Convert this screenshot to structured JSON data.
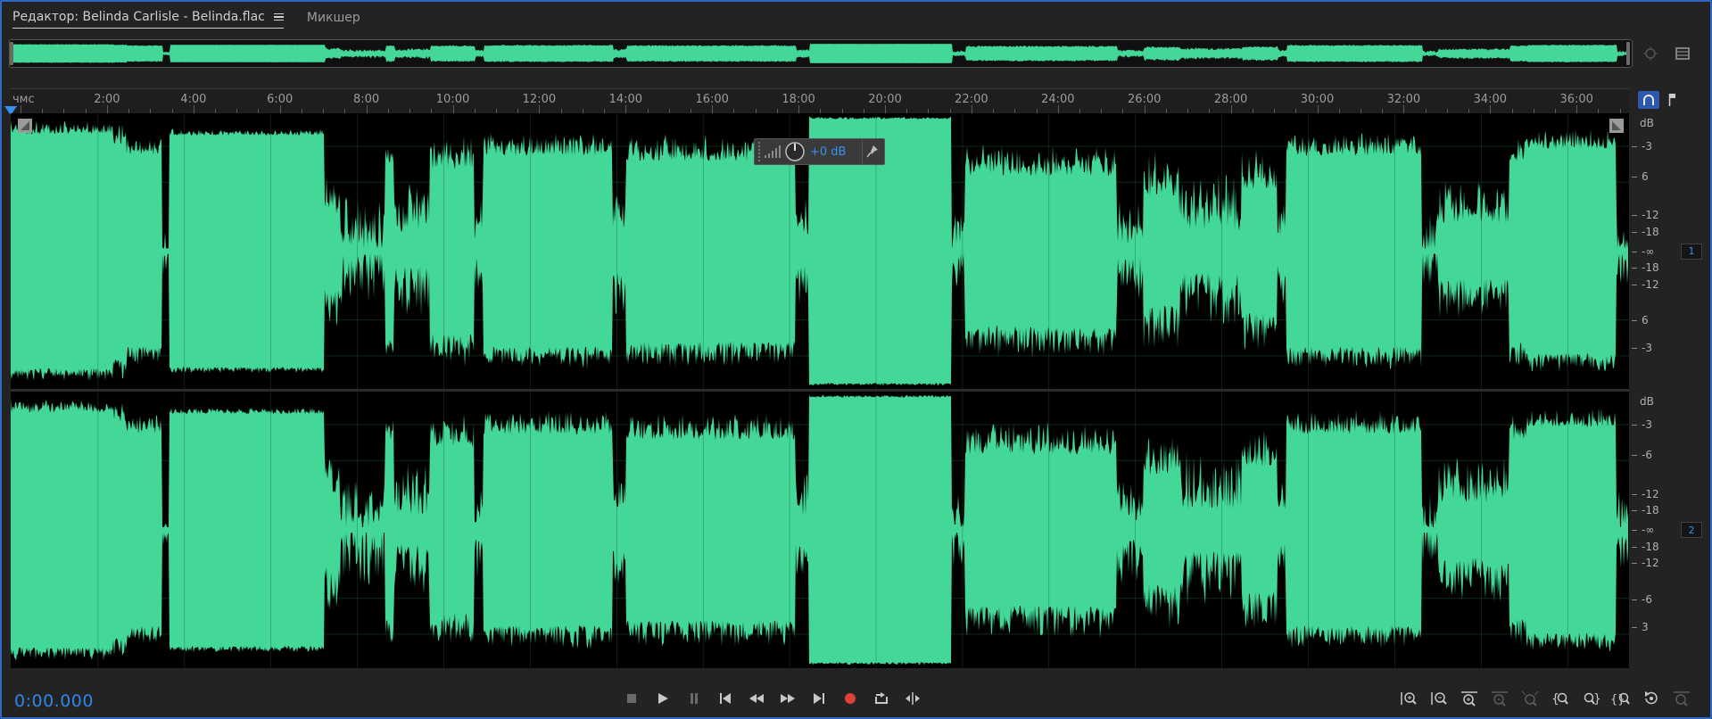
{
  "tabs": {
    "editor": "Редактор: Belinda Carlisle - Belinda.flac",
    "mixer": "Микшер"
  },
  "ruler": {
    "unit": "чмс",
    "labels": [
      "2:00",
      "4:00",
      "6:00",
      "8:00",
      "10:00",
      "12:00",
      "14:00",
      "16:00",
      "18:00",
      "20:00",
      "22:00",
      "24:00",
      "26:00",
      "28:00",
      "30:00",
      "32:00",
      "34:00",
      "36:00"
    ]
  },
  "hud": {
    "value": "+0 dB"
  },
  "db_scale": {
    "channel1": {
      "header": "dB",
      "labels": [
        "-3",
        "6",
        "-12",
        "-18",
        "-∞",
        "-18",
        "-12",
        "6",
        "-3"
      ],
      "badge": "1"
    },
    "channel2": {
      "header": "dB",
      "labels": [
        "-3",
        "-6",
        "-12",
        "-18",
        "-∞",
        "-18",
        "-12",
        "-6",
        "3"
      ],
      "badge": "2"
    }
  },
  "time": "0:00.000",
  "colors": {
    "waveform": "#43d898",
    "accent": "#2e86e6",
    "record": "#e0403a",
    "background": "#232323"
  },
  "icons": {
    "transport": [
      "stop-icon",
      "play-icon",
      "pause-icon",
      "go-to-start-icon",
      "rewind-icon",
      "fast-forward-icon",
      "go-to-end-icon",
      "record-icon",
      "loop-icon",
      "skip-selection-icon"
    ],
    "zoom": [
      "zoom-in-amplitude-icon",
      "zoom-out-amplitude-icon",
      "zoom-in-time-icon",
      "zoom-out-full-icon",
      "zoom-to-selection-icon",
      "zoom-in-left-icon",
      "zoom-in-right-icon",
      "zoom-selection-icon",
      "zoom-reset-icon",
      "zoom-out-time-icon"
    ]
  }
}
